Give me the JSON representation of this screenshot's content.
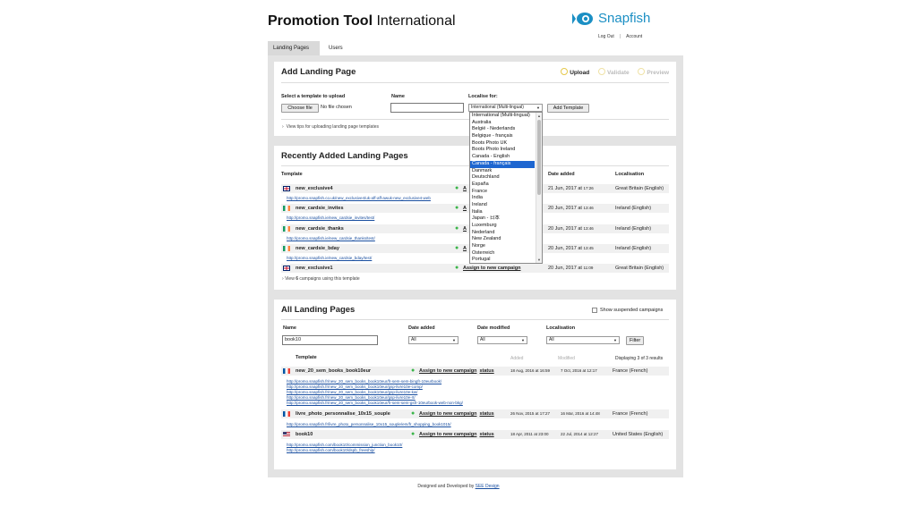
{
  "header": {
    "title_bold": "Promotion Tool",
    "title_light": "International",
    "logo_text": "Snapfish",
    "logout": "Log Out",
    "account": "Account",
    "separator": "|"
  },
  "tabs": [
    {
      "label": "Landing Pages",
      "active": true
    },
    {
      "label": "Users",
      "active": false
    }
  ],
  "add_panel": {
    "title": "Add Landing Page",
    "steps": [
      {
        "label": "Upload",
        "active": true
      },
      {
        "label": "Validate",
        "active": false
      },
      {
        "label": "Preview",
        "active": false
      }
    ],
    "template_label": "Select a template to upload",
    "choose_file": "Choose file",
    "no_file": "No file chosen",
    "name_label": "Name",
    "name_value": "",
    "localise_label": "Localise for:",
    "localise_selected": "International (Multi-lingual)",
    "add_template": "Add Template",
    "tips": "View tips for uploading landing page templates"
  },
  "dropdown": {
    "options": [
      "International (Multi-lingual)",
      "Australia",
      "België - Nederlands",
      "Belgique - français",
      "Boots Photo UK",
      "Boots Photo Ireland",
      "Canada - English",
      "Canada - français",
      "Danmark",
      "Deutschland",
      "España",
      "France",
      "India",
      "Ireland",
      "Italia",
      "Japan - 日本",
      "Luxemburg",
      "Nederland",
      "New Zealand",
      "Norge",
      "Österreich",
      "Portugal"
    ],
    "highlighted": "Canada - français"
  },
  "recent_panel": {
    "title": "Recently Added Landing Pages",
    "columns": {
      "template": "Template",
      "date_added": "Date added",
      "localisation": "Localisation"
    },
    "rows": [
      {
        "flag": "uk",
        "name": "new_exclusive4",
        "assign": "A",
        "date": "21 Jun, 2017 at",
        "time": "17:26",
        "localisation": "Great Britain (English)",
        "url": "http://promo.snapfish.co.uk/new_exclusive4/uk-aff-aff-awuk-new_exclusive4-web"
      },
      {
        "flag": "ie",
        "name": "new_cardsie_invites",
        "assign": "A",
        "date": "20 Jun, 2017 at",
        "time": "13:46",
        "localisation": "Ireland (English)",
        "url": "http://promo.snapfish.ie/new_cardsie_invites/test/"
      },
      {
        "flag": "ie",
        "name": "new_cardsie_thanks",
        "assign": "A",
        "date": "20 Jun, 2017 at",
        "time": "13:46",
        "localisation": "Ireland (English)",
        "url": "http://promo.snapfish.ie/new_cardsie_thanks/test/"
      },
      {
        "flag": "ie",
        "name": "new_cardsie_bday",
        "assign": "A",
        "date": "20 Jun, 2017 at",
        "time": "13:45",
        "localisation": "Ireland (English)",
        "url": "http://promo.snapfish.ie/new_cardsie_bday/test/"
      },
      {
        "flag": "uk",
        "name": "new_exclusive1",
        "assign": "Assign to new campaign",
        "date": "20 Jun, 2017 at",
        "time": "11:09",
        "localisation": "Great Britain (English)",
        "url": ""
      }
    ],
    "more_prefix": "View ",
    "more_count": "6",
    "more_suffix": " campaigns using this template"
  },
  "all_panel": {
    "title": "All Landing Pages",
    "show_suspended": "Show suspended campaigns",
    "filters": {
      "name_label": "Name",
      "name_value": "book10",
      "date_added_label": "Date added",
      "date_added_value": "All",
      "date_modified_label": "Date modified",
      "date_modified_value": "All",
      "localisation_label": "Localisation",
      "localisation_value": "All",
      "filter_button": "Filter"
    },
    "columns": {
      "template": "Template",
      "added": "Added",
      "modified": "Modified"
    },
    "results": "Displaying 3 of 3 results",
    "rows": [
      {
        "flag": "fr",
        "name": "new_20_sem_books_book10eur",
        "assign": "Assign to new campaign",
        "status": "status",
        "added": "18 Aug, 2016 at 16:59",
        "modified": "7 Oct, 2016 at 12:17",
        "localisation": "France (French)",
        "urls": [
          "http://promo.snapfish.fr/new_20_sem_books_book10eur/fr-sem-sem-bingfr-10eurbook/",
          "http://promo.snapfish.fr/new_20_sem_books_book10eur/gsp-livre10e-comp/",
          "http://promo.snapfish.fr/new_20_sem_books_book10eur/gsp-livre10e-kw/",
          "http://promo.snapfish.fr/new_20_sem_books_book10eur/gsp-livre10e-rt/",
          "http://promo.snapfish.fr/new_20_sem_books_book10eur/fr-sem-sem-gsfr-10eurbook-web-non-bkg/"
        ]
      },
      {
        "flag": "fr",
        "name": "livre_photo_personnalise_10x15_souple",
        "assign": "Assign to new campaign",
        "status": "status",
        "added": "26 Nov, 2015 at 17:27",
        "modified": "16 Mar, 2016 at 14:48",
        "localisation": "France (French)",
        "urls": [
          "http://promo.snapfish.fr/livre_photo_personnalise_10x15_souple/em/fr_shopping_book1015/"
        ]
      },
      {
        "flag": "us",
        "name": "book10",
        "assign": "Assign to new campaign",
        "status": "status",
        "added": "18 Apr, 2011 at 23:00",
        "modified": "22 Jul, 2014 at 12:27",
        "localisation": "United States (English)",
        "urls": [
          "http://promo.snapfish.com/book10/commission_junction_book10/",
          "http://promo.snapfish.com/book10/dspb_freeship/"
        ]
      }
    ]
  },
  "footer": {
    "text": "Designed and Developed by ",
    "link": "SEE Design"
  },
  "colors": {
    "brand_blue": "#1b8fc4",
    "selection_blue": "#1e66d0",
    "status_green": "#3bb54a",
    "panel_bg": "#e3e3e3"
  }
}
